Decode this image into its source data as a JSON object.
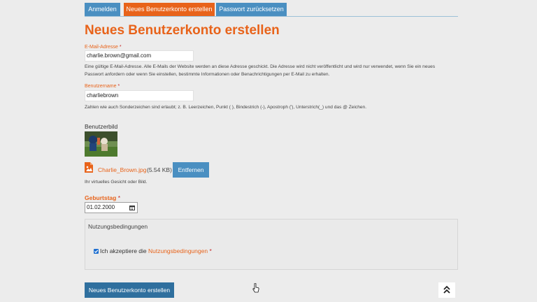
{
  "tabs": [
    {
      "label": "Anmelden"
    },
    {
      "label": "Neues Benutzerkonto erstellen"
    },
    {
      "label": "Passwort zurücksetzen"
    }
  ],
  "page_title": "Neues Benutzerkonto erstellen",
  "email": {
    "label": "E-Mail-Adresse",
    "required_mark": "*",
    "value": "charlie.brown@gmail.com",
    "help_line1": "Eine gültige E-Mail-Adresse. Alle E-Mails der Website werden an diese Adresse geschickt. Die Adresse wird nicht veröffentlicht und wird nur verwendet, wenn Sie ein neues",
    "help_line2": "Passwort anfordern oder wenn Sie einstellen, bestimmte Informationen oder Benachrichtigungen per E-Mail zu erhalten."
  },
  "username": {
    "label": "Benutzername",
    "required_mark": "*",
    "value": "charliebrown",
    "help": "Zahlen wie auch Sonderzeichen sind erlaubt; z. B. Leerzeichen, Punkt ( ), Bindestrich (-), Apostroph ('), Unterstrich(_) und das @ Zeichen."
  },
  "picture": {
    "label": "Benutzerbild",
    "file_name": "Charlie_Brown.jpg",
    "file_size": "(5.54 KB)",
    "remove_label": "Entfernen",
    "help": "Ihr virtuelles Gesicht oder Bild."
  },
  "birthday": {
    "label": "Geburtstag",
    "required_mark": "*",
    "value": "01.02.2000"
  },
  "terms": {
    "legend": "Nutzungsbedingungen",
    "checkbox_text": "Ich akzeptiere die ",
    "link_text": "Nutzungsbedingungen",
    "required_mark": "*",
    "checked": true
  },
  "submit_label": "Neues Benutzerkonto erstellen",
  "colors": {
    "accent": "#e8631a",
    "tab_blue": "#4a8fc1",
    "button_dark": "#2f6f9e",
    "background": "#ececec"
  }
}
